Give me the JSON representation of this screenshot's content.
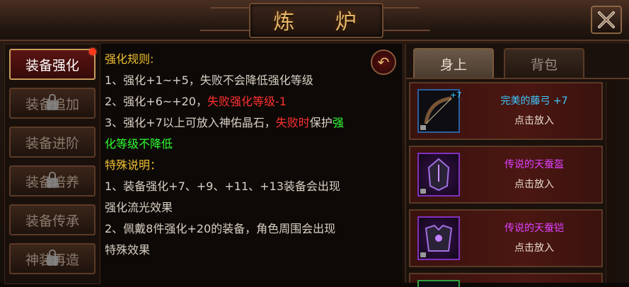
{
  "window": {
    "title": "炼 炉"
  },
  "menu": {
    "items": [
      {
        "label": "装备强化",
        "active": true,
        "badge": true,
        "locked": false
      },
      {
        "label": "装备追加",
        "active": false,
        "badge": false,
        "locked": true
      },
      {
        "label": "装备进阶",
        "active": false,
        "badge": false,
        "locked": false
      },
      {
        "label": "装备培养",
        "active": false,
        "badge": false,
        "locked": true
      },
      {
        "label": "装备传承",
        "active": false,
        "badge": false,
        "locked": false
      },
      {
        "label": "神装再造",
        "active": false,
        "badge": false,
        "locked": true
      }
    ]
  },
  "rules": {
    "heading": "强化规则:",
    "line1": "1、强化+1~+5，失败不会降低强化等级",
    "line2_a": "2、强化+6~+20，",
    "line2_b": "失败强化等级-1",
    "line3_a": "3、强化+7以上可放入神佑晶石，",
    "line3_b": "失败时",
    "line3_c": "保护",
    "line3_d": "强",
    "line4": "化等级不降低",
    "special_heading": "特殊说明：",
    "s1a": "1、装备强化+7、+9、+11、+13装备会出现",
    "s1b": "强化流光效果",
    "s2a": "2、佩戴8件强化+20的装备，角色周围会出现",
    "s2b": "特殊效果"
  },
  "tabs": {
    "on_body": "身上",
    "backpack": "背包"
  },
  "items": [
    {
      "name": "完美的藤弓 +7",
      "name_color": "#40c8ff",
      "plus": "+7",
      "action": "点击放入",
      "icon": "bow-icon"
    },
    {
      "name": "传说的天蚕盔",
      "name_color": "#e040ff",
      "action": "点击放入",
      "icon": "helmet-icon"
    },
    {
      "name": "传说的天蚕铠",
      "name_color": "#e040ff",
      "action": "点击放入",
      "icon": "armor-icon"
    }
  ],
  "colors": {
    "accent_gold": "#e8b86a",
    "warn_red": "#ff3030",
    "ok_green": "#30ff30",
    "legend_purple": "#e040ff"
  }
}
